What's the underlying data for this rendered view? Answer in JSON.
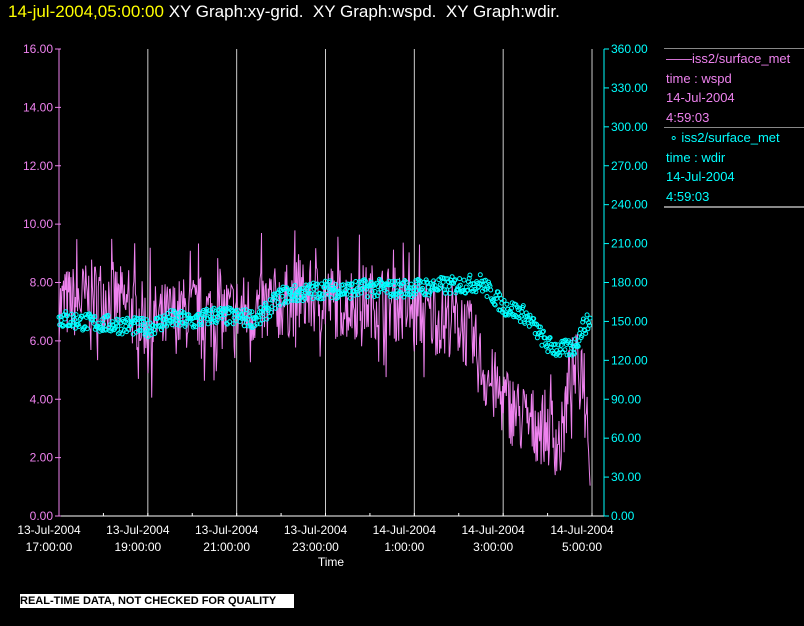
{
  "header": {
    "timestamp": "14-jul-2004,05:00:00",
    "titles": " XY Graph:xy-grid.  XY Graph:wspd.  XY Graph:wdir."
  },
  "legend": [
    {
      "marker": "——",
      "name": "iss2/surface_met",
      "line2": "time : wspd",
      "date": "14-Jul-2004",
      "time": "4:59:03",
      "color": "#ee82ee"
    },
    {
      "marker": "∘ ",
      "name": "iss2/surface_met",
      "line2": "time : wdir",
      "date": "14-Jul-2004",
      "time": "4:59:03",
      "color": "#00ffff"
    }
  ],
  "footer": "REAL-TIME DATA, NOT CHECKED FOR QUALITY",
  "chart_data": {
    "type": "line",
    "xlabel": "Time",
    "x_unit": "hours since 13-Jul-2004 17:00",
    "xlim": [
      0,
      12.27
    ],
    "x_ticks": [
      {
        "v": 0,
        "d": "13-Jul-2004",
        "t": "17:00:00"
      },
      {
        "v": 2,
        "d": "13-Jul-2004",
        "t": "19:00:00"
      },
      {
        "v": 4,
        "d": "13-Jul-2004",
        "t": "21:00:00"
      },
      {
        "v": 6,
        "d": "13-Jul-2004",
        "t": "23:00:00"
      },
      {
        "v": 8,
        "d": "14-Jul-2004",
        "t": "1:00:00"
      },
      {
        "v": 10,
        "d": "14-Jul-2004",
        "t": "3:00:00"
      },
      {
        "v": 12,
        "d": "14-Jul-2004",
        "t": "5:00:00"
      }
    ],
    "y_left": {
      "lim": [
        0,
        16
      ],
      "ticks": [
        "0.00",
        "2.00",
        "4.00",
        "6.00",
        "8.00",
        "10.00",
        "12.00",
        "14.00",
        "16.00"
      ]
    },
    "y_right": {
      "lim": [
        0,
        360
      ],
      "ticks": [
        "0.00",
        "30.00",
        "60.00",
        "90.00",
        "120.00",
        "150.00",
        "180.00",
        "210.00",
        "240.00",
        "270.00",
        "300.00",
        "330.00",
        "360.00"
      ]
    },
    "grid": "vertical",
    "series": [
      {
        "name": "wspd",
        "axis": "left",
        "style": "line",
        "color": "#ee82ee",
        "noise": 1.3,
        "x": [
          0,
          0.5,
          1,
          1.5,
          2,
          2.5,
          3,
          3.5,
          4,
          4.5,
          5,
          5.5,
          6,
          6.5,
          7,
          7.5,
          8,
          8.5,
          9,
          9.3,
          9.6,
          10,
          10.5,
          11,
          11.3,
          11.5,
          11.8,
          11.96
        ],
        "y": [
          7.2,
          7.4,
          7.6,
          7.2,
          6.6,
          6.8,
          7.0,
          6.9,
          7.0,
          7.1,
          7.3,
          7.5,
          7.4,
          7.3,
          7.4,
          7.3,
          7.0,
          6.8,
          6.7,
          6.0,
          4.8,
          4.0,
          3.2,
          3.0,
          2.4,
          4.8,
          5.2,
          2.2
        ]
      },
      {
        "name": "wdir",
        "axis": "right",
        "style": "circles",
        "color": "#00ffff",
        "noise": 7,
        "x": [
          0,
          0.5,
          1,
          1.5,
          2,
          2.5,
          3,
          3.5,
          4,
          4.5,
          5,
          5.5,
          6,
          6.5,
          7,
          7.5,
          8,
          8.5,
          9,
          9.5,
          10,
          10.5,
          11,
          11.3,
          11.6,
          11.8,
          11.96
        ],
        "y": [
          152,
          150,
          148,
          147,
          145,
          152,
          150,
          155,
          153,
          152,
          170,
          172,
          175,
          174,
          176,
          175,
          176,
          177,
          178,
          180,
          162,
          155,
          132,
          128,
          130,
          146,
          150
        ]
      }
    ]
  }
}
